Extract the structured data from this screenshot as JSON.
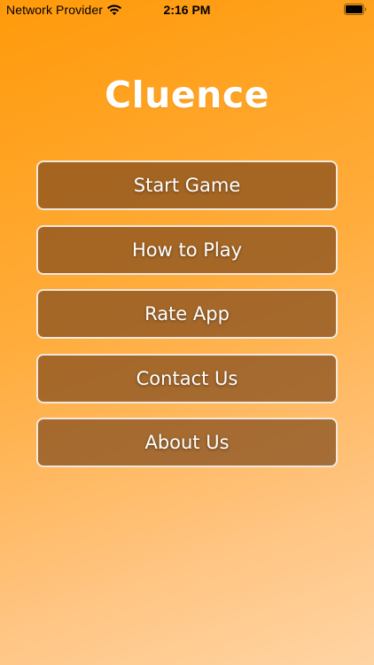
{
  "status_bar": {
    "carrier": "Network Provider",
    "time": "2:16 PM",
    "wifi_icon": "wifi-icon",
    "battery_icon": "battery-icon"
  },
  "app": {
    "title": "Cluence"
  },
  "menu": {
    "items": [
      {
        "label": "Start Game"
      },
      {
        "label": "How to Play"
      },
      {
        "label": "Rate App"
      },
      {
        "label": "Contact Us"
      },
      {
        "label": "About Us"
      }
    ]
  },
  "colors": {
    "background_start": "#ff9a0a",
    "background_end": "#ffd4a3",
    "button_fill": "#824c1e",
    "button_border": "#ffffff",
    "text": "#ffffff"
  }
}
